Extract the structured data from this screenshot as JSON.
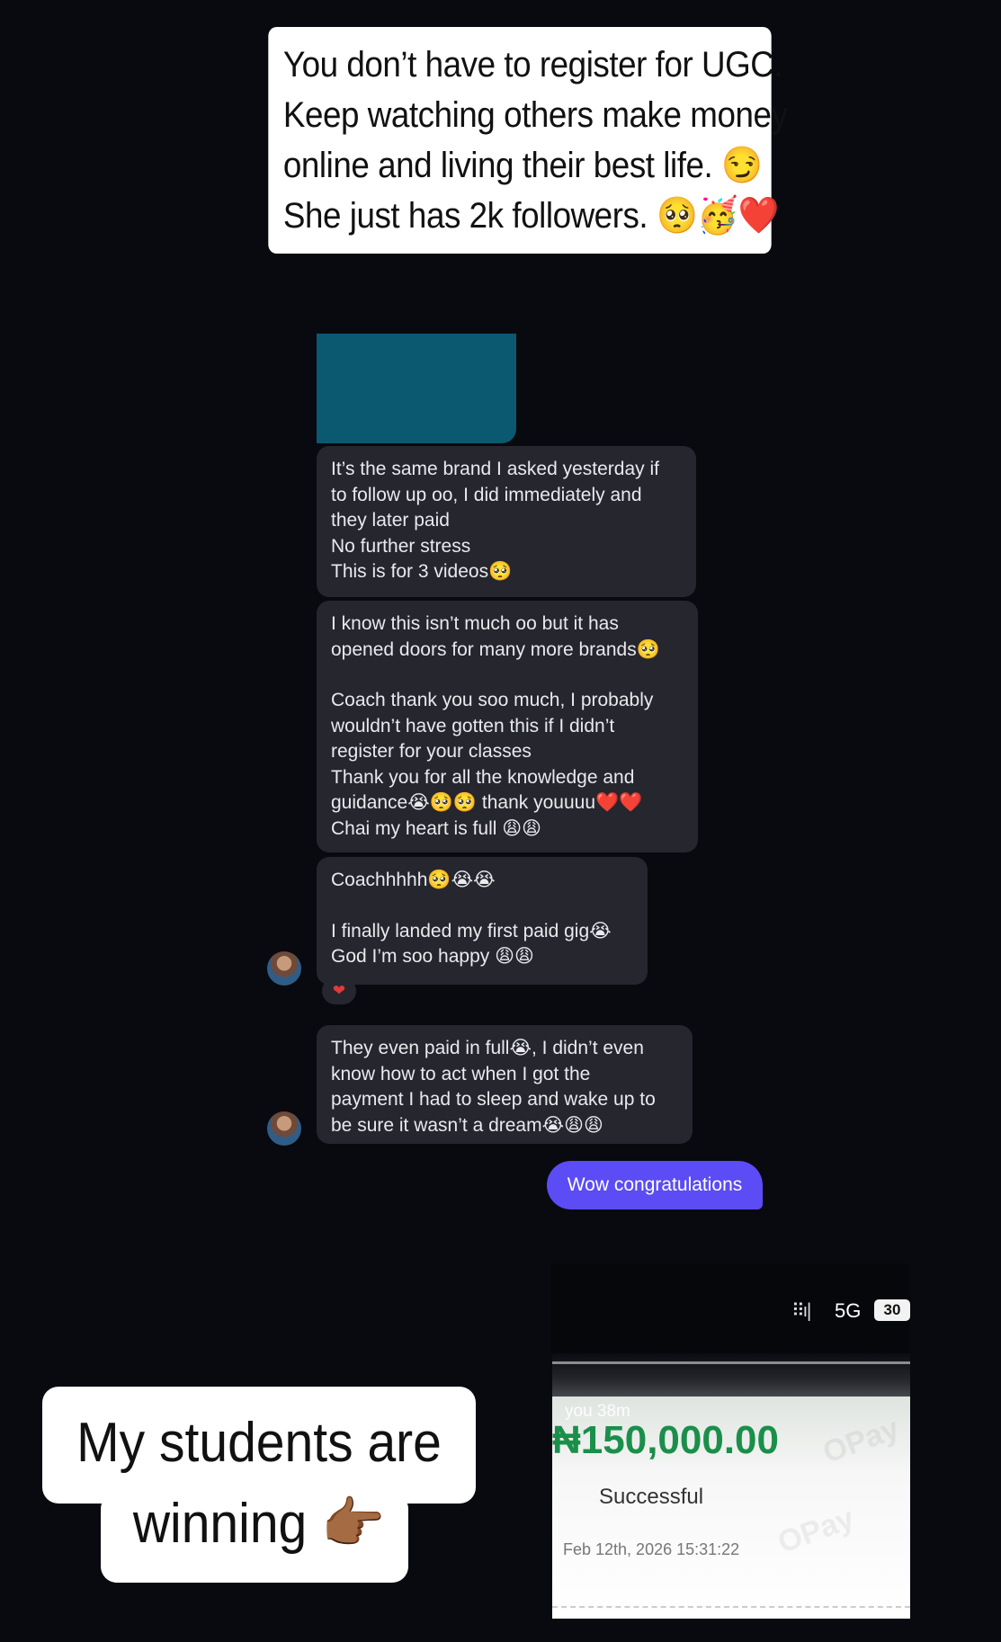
{
  "caption_top": {
    "lines": [
      "You don’t have to register for UGC.",
      "Keep watching others make money",
      "online and living their best life. 😏",
      "She just has 2k followers. 🥺🥳❤️"
    ]
  },
  "chat": {
    "messages": [
      {
        "lines": [
          "It’s the same brand I asked yesterday if",
          "to follow up oo, I did immediately and",
          "they later paid",
          "No further stress",
          "This is for 3 videos🥺"
        ]
      },
      {
        "lines": [
          "I know this isn’t much oo but it has",
          "opened doors for many more brands🥺",
          "",
          "Coach thank you soo much, I probably",
          "wouldn’t have gotten this if I didn’t",
          "register for your classes",
          "Thank you for all the knowledge and",
          "guidance😭🥺🥺 thank youuuu❤️❤️",
          "Chai my heart is full 😩😩"
        ]
      },
      {
        "lines": [
          "Coachhhhh🥺😭😭",
          "",
          "I finally landed my first paid gig😭",
          "God I’m soo happy 😩😩"
        ],
        "reaction": "❤"
      },
      {
        "lines": [
          "They even paid in full😭, I didn’t even",
          "know how to act when I got the",
          "payment I had to sleep and wake up to",
          "be sure it wasn’t a dream😭😩😩"
        ]
      }
    ],
    "sent_message": "Wow congratulations"
  },
  "receipt": {
    "network": "5G",
    "battery": "30",
    "sender": "you 38m",
    "amount": "₦150,000.00",
    "status": "Successful",
    "datetime": "Feb 12th, 2026 15:31:22",
    "watermark": "OPay"
  },
  "caption_bottom": {
    "lines": [
      "My students are",
      "winning 👉🏾"
    ]
  },
  "icons": {
    "avatar": "avatar-icon",
    "signal": "signal-icon",
    "battery": "battery-icon",
    "reaction": "heart-icon"
  }
}
